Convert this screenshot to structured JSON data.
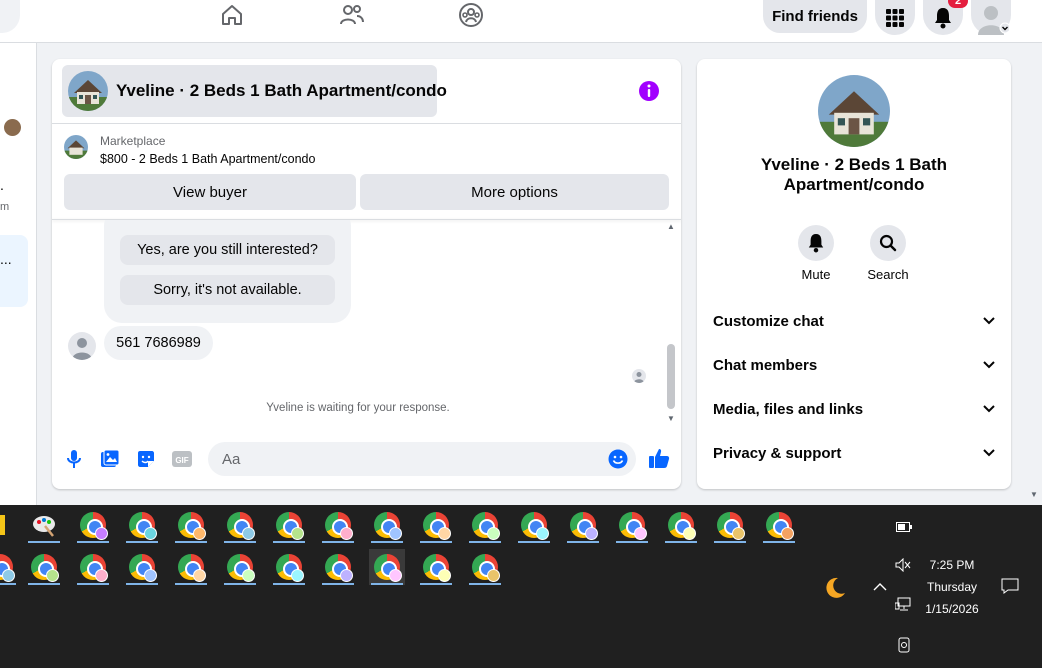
{
  "topnav": {
    "find_friends_label": "Find friends",
    "notification_count": "2"
  },
  "left_fragments": {
    "frag1": ".",
    "frag2": "m",
    "frag3": "..."
  },
  "chat": {
    "title": "Yveline · 2 Beds 1 Bath Apartment/condo",
    "marketplace_label": "Marketplace",
    "listing_price_line": "$800 - 2 Beds 1 Bath Apartment/condo",
    "view_buyer_label": "View buyer",
    "more_options_label": "More options",
    "quick_reply_1": "Yes, are you still interested?",
    "quick_reply_2": "Sorry, it's not available.",
    "message_text": "561 7686989",
    "waiting_text": "Yveline is waiting for your response.",
    "composer_placeholder": "Aa",
    "accent_color": "#0866ff",
    "info_color": "#a200ff"
  },
  "right_panel": {
    "title": "Yveline · 2 Beds 1 Bath Apartment/condo",
    "mute_label": "Mute",
    "search_label": "Search",
    "rows": [
      "Customize chat",
      "Chat members",
      "Media, files and links",
      "Privacy & support"
    ]
  },
  "taskbar": {
    "time": "7:25 PM",
    "day": "Thursday",
    "date": "1/15/2026"
  }
}
